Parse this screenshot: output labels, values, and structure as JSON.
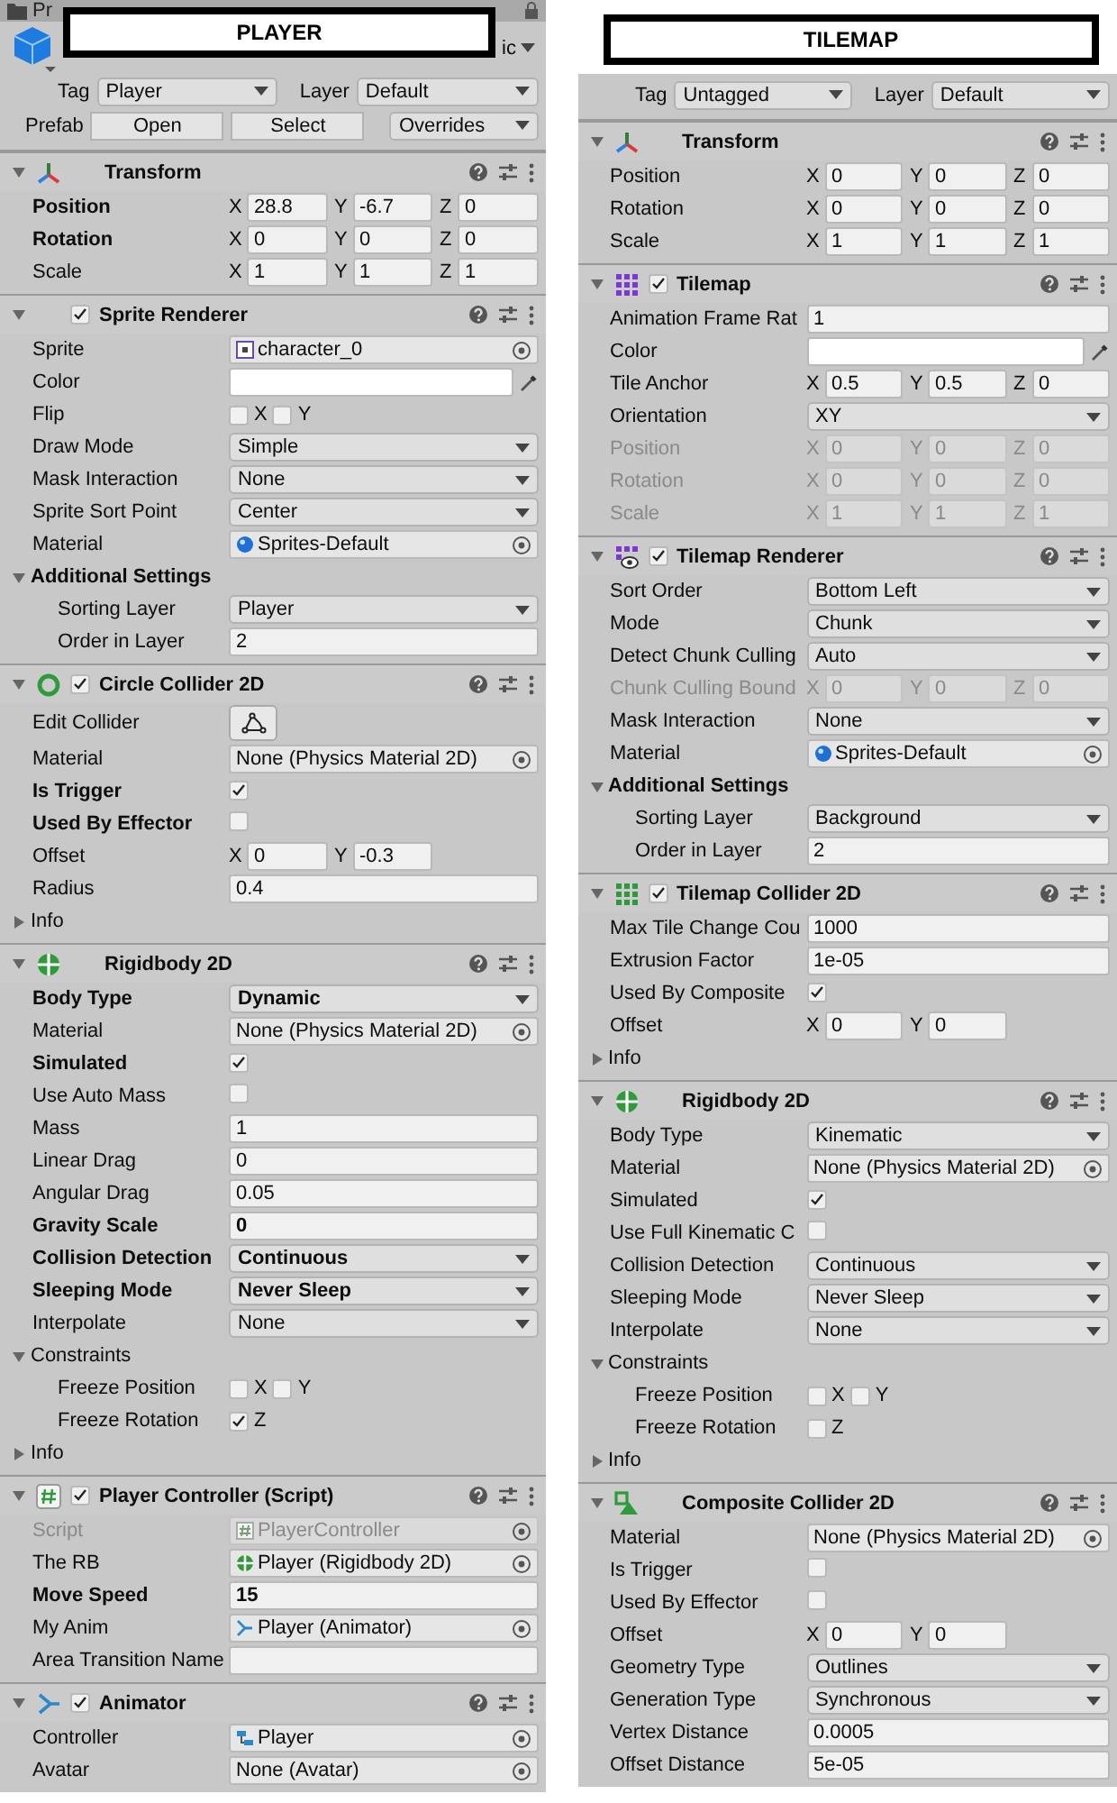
{
  "panels": [
    {
      "banner": "PLAYER",
      "tab": "Pr",
      "static": "ic",
      "tag": {
        "label": "Tag",
        "value": "Player"
      },
      "layer": {
        "label": "Layer",
        "value": "Default"
      },
      "prefab": {
        "label": "Prefab",
        "buttons": [
          "Open",
          "Select"
        ],
        "overrides": "Overrides"
      },
      "components": [
        {
          "name": "Transform",
          "kind": "transform",
          "expanded": true,
          "rows": [
            {
              "kind": "vector",
              "label": "Position",
              "overridden": true,
              "disabled": false,
              "items": [
                {
                  "axis": "X",
                  "value": "28.8"
                },
                {
                  "axis": "Y",
                  "value": "-6.7"
                },
                {
                  "axis": "Z",
                  "value": "0"
                }
              ]
            },
            {
              "kind": "vector",
              "label": "Rotation",
              "overridden": true,
              "disabled": false,
              "items": [
                {
                  "axis": "X",
                  "value": "0"
                },
                {
                  "axis": "Y",
                  "value": "0"
                },
                {
                  "axis": "Z",
                  "value": "0"
                }
              ]
            },
            {
              "kind": "vector",
              "label": "Scale",
              "overridden": false,
              "disabled": false,
              "items": [
                {
                  "axis": "X",
                  "value": "1"
                },
                {
                  "axis": "Y",
                  "value": "1"
                },
                {
                  "axis": "Z",
                  "value": "1"
                }
              ]
            }
          ]
        },
        {
          "name": "Sprite Renderer",
          "kind": "renderer",
          "enabled": true,
          "expanded": true,
          "rows": [
            {
              "kind": "sprite-ref",
              "label": "Sprite",
              "overridden": false,
              "disabled": false,
              "value": "character_0"
            },
            {
              "kind": "color",
              "label": "Color",
              "overridden": false,
              "disabled": false,
              "color": "#ffffff"
            },
            {
              "kind": "checks",
              "label": "Flip",
              "overridden": false,
              "disabled": false,
              "checks": [
                {
                  "axis": "X",
                  "checked": false
                },
                {
                  "axis": "Y",
                  "checked": false
                }
              ]
            },
            {
              "kind": "dropdown",
              "label": "Draw Mode",
              "overridden": false,
              "disabled": false,
              "value": "Simple"
            },
            {
              "kind": "dropdown",
              "label": "Mask Interaction",
              "overridden": false,
              "disabled": false,
              "value": "None"
            },
            {
              "kind": "dropdown",
              "label": "Sprite Sort Point",
              "overridden": false,
              "disabled": false,
              "value": "Center"
            },
            {
              "kind": "material-ref",
              "label": "Material",
              "overridden": false,
              "disabled": false,
              "value": "Sprites-Default"
            },
            {
              "kind": "foldout",
              "label": "Additional Settings",
              "overridden": true,
              "disabled": false,
              "expanded": true,
              "children": [
                {
                  "kind": "dropdown",
                  "label": "Sorting Layer",
                  "overridden": false,
                  "disabled": false,
                  "value": "Player"
                },
                {
                  "kind": "number",
                  "label": "Order in Layer",
                  "overridden": false,
                  "disabled": false,
                  "value": "2"
                }
              ]
            }
          ]
        },
        {
          "name": "Circle Collider 2D",
          "kind": "circle-collider",
          "enabled": true,
          "expanded": true,
          "rows": [
            {
              "kind": "edit-button",
              "label": "Edit Collider",
              "overridden": false,
              "disabled": false
            },
            {
              "kind": "object",
              "label": "Material",
              "overridden": false,
              "disabled": false,
              "value": "None (Physics Material 2D)"
            },
            {
              "kind": "checkbox",
              "label": "Is Trigger",
              "overridden": true,
              "disabled": false,
              "checked": true
            },
            {
              "kind": "checkbox",
              "label": "Used By Effector",
              "overridden": true,
              "disabled": false,
              "checked": false
            },
            {
              "kind": "vector",
              "label": "Offset",
              "overridden": false,
              "disabled": false,
              "items": [
                {
                  "axis": "X",
                  "value": "0"
                },
                {
                  "axis": "Y",
                  "value": "-0.3"
                }
              ]
            },
            {
              "kind": "number",
              "label": "Radius",
              "overridden": false,
              "disabled": false,
              "value": "0.4"
            },
            {
              "kind": "foldout",
              "label": "Info",
              "overridden": false,
              "disabled": false,
              "expanded": false
            }
          ]
        },
        {
          "name": "Rigidbody 2D",
          "kind": "rigidbody",
          "expanded": true,
          "rows": [
            {
              "kind": "dropdown",
              "label": "Body Type",
              "overridden": true,
              "disabled": false,
              "value": "Dynamic"
            },
            {
              "kind": "object",
              "label": "Material",
              "overridden": false,
              "disabled": false,
              "value": "None (Physics Material 2D)"
            },
            {
              "kind": "checkbox",
              "label": "Simulated",
              "overridden": true,
              "disabled": false,
              "checked": true
            },
            {
              "kind": "checkbox",
              "label": "Use Auto Mass",
              "overridden": false,
              "disabled": false,
              "checked": false
            },
            {
              "kind": "number",
              "label": "Mass",
              "overridden": false,
              "disabled": false,
              "value": "1"
            },
            {
              "kind": "number",
              "label": "Linear Drag",
              "overridden": false,
              "disabled": false,
              "value": "0"
            },
            {
              "kind": "number",
              "label": "Angular Drag",
              "overridden": false,
              "disabled": false,
              "value": "0.05"
            },
            {
              "kind": "number",
              "label": "Gravity Scale",
              "overridden": true,
              "disabled": false,
              "value": "0"
            },
            {
              "kind": "dropdown",
              "label": "Collision Detection",
              "overridden": true,
              "disabled": false,
              "value": "Continuous"
            },
            {
              "kind": "dropdown",
              "label": "Sleeping Mode",
              "overridden": true,
              "disabled": false,
              "value": "Never Sleep"
            },
            {
              "kind": "dropdown",
              "label": "Interpolate",
              "overridden": false,
              "disabled": false,
              "value": "None"
            },
            {
              "kind": "foldout",
              "label": "Constraints",
              "overridden": false,
              "disabled": false,
              "expanded": true,
              "children": [
                {
                  "kind": "checks",
                  "label": "Freeze Position",
                  "overridden": false,
                  "disabled": false,
                  "checks": [
                    {
                      "axis": "X",
                      "checked": false
                    },
                    {
                      "axis": "Y",
                      "checked": false
                    }
                  ]
                },
                {
                  "kind": "checks",
                  "label": "Freeze Rotation",
                  "overridden": false,
                  "disabled": false,
                  "checks": [
                    {
                      "axis": "Z",
                      "checked": true
                    }
                  ]
                }
              ]
            },
            {
              "kind": "foldout",
              "label": "Info",
              "overridden": false,
              "disabled": false,
              "expanded": false
            }
          ]
        },
        {
          "name": "Player Controller (Script)",
          "kind": "script",
          "enabled": true,
          "expanded": true,
          "rows": [
            {
              "kind": "script-ref",
              "label": "Script",
              "overridden": false,
              "disabled": true,
              "value": "PlayerController"
            },
            {
              "kind": "rigidbody-ref",
              "label": "The RB",
              "overridden": false,
              "disabled": false,
              "value": "Player (Rigidbody 2D)"
            },
            {
              "kind": "number",
              "label": "Move Speed",
              "overridden": true,
              "disabled": false,
              "value": "15"
            },
            {
              "kind": "animator-ref",
              "label": "My Anim",
              "overridden": false,
              "disabled": false,
              "value": "Player (Animator)"
            },
            {
              "kind": "number",
              "label": "Area Transition Name",
              "overridden": false,
              "disabled": false
            }
          ]
        },
        {
          "name": "Animator",
          "kind": "animator",
          "enabled": true,
          "expanded": true,
          "rows": [
            {
              "kind": "controller-ref",
              "label": "Controller",
              "overridden": false,
              "disabled": false,
              "value": "Player"
            },
            {
              "kind": "object",
              "label": "Avatar",
              "overridden": false,
              "disabled": false,
              "value": "None (Avatar)"
            }
          ]
        }
      ]
    },
    {
      "banner": "TILEMAP",
      "tag": {
        "label": "Tag",
        "value": "Untagged"
      },
      "layer": {
        "label": "Layer",
        "value": "Default"
      },
      "components": [
        {
          "name": "Transform",
          "kind": "transform",
          "expanded": true,
          "rows": [
            {
              "kind": "vector",
              "label": "Position",
              "overridden": false,
              "disabled": false,
              "items": [
                {
                  "axis": "X",
                  "value": "0"
                },
                {
                  "axis": "Y",
                  "value": "0"
                },
                {
                  "axis": "Z",
                  "value": "0"
                }
              ]
            },
            {
              "kind": "vector",
              "label": "Rotation",
              "overridden": false,
              "disabled": false,
              "items": [
                {
                  "axis": "X",
                  "value": "0"
                },
                {
                  "axis": "Y",
                  "value": "0"
                },
                {
                  "axis": "Z",
                  "value": "0"
                }
              ]
            },
            {
              "kind": "vector",
              "label": "Scale",
              "overridden": false,
              "disabled": false,
              "items": [
                {
                  "axis": "X",
                  "value": "1"
                },
                {
                  "axis": "Y",
                  "value": "1"
                },
                {
                  "axis": "Z",
                  "value": "1"
                }
              ]
            }
          ]
        },
        {
          "name": "Tilemap",
          "kind": "tilemap",
          "enabled": true,
          "expanded": true,
          "rows": [
            {
              "kind": "number",
              "label": "Animation Frame Rat",
              "overridden": false,
              "disabled": false,
              "value": "1"
            },
            {
              "kind": "color",
              "label": "Color",
              "overridden": false,
              "disabled": false,
              "color": "#ffffff"
            },
            {
              "kind": "vector",
              "label": "Tile Anchor",
              "overridden": false,
              "disabled": false,
              "items": [
                {
                  "axis": "X",
                  "value": "0.5"
                },
                {
                  "axis": "Y",
                  "value": "0.5"
                },
                {
                  "axis": "Z",
                  "value": "0"
                }
              ]
            },
            {
              "kind": "dropdown",
              "label": "Orientation",
              "overridden": false,
              "disabled": false,
              "value": "XY"
            },
            {
              "kind": "vector",
              "label": "Position",
              "overridden": false,
              "disabled": true,
              "items": [
                {
                  "axis": "X",
                  "value": "0"
                },
                {
                  "axis": "Y",
                  "value": "0"
                },
                {
                  "axis": "Z",
                  "value": "0"
                }
              ]
            },
            {
              "kind": "vector",
              "label": "Rotation",
              "overridden": false,
              "disabled": true,
              "items": [
                {
                  "axis": "X",
                  "value": "0"
                },
                {
                  "axis": "Y",
                  "value": "0"
                },
                {
                  "axis": "Z",
                  "value": "0"
                }
              ]
            },
            {
              "kind": "vector",
              "label": "Scale",
              "overridden": false,
              "disabled": true,
              "items": [
                {
                  "axis": "X",
                  "value": "1"
                },
                {
                  "axis": "Y",
                  "value": "1"
                },
                {
                  "axis": "Z",
                  "value": "1"
                }
              ]
            }
          ]
        },
        {
          "name": "Tilemap Renderer",
          "kind": "tilemap-renderer",
          "enabled": true,
          "expanded": true,
          "rows": [
            {
              "kind": "dropdown",
              "label": "Sort Order",
              "overridden": false,
              "disabled": false,
              "value": "Bottom Left"
            },
            {
              "kind": "dropdown",
              "label": "Mode",
              "overridden": false,
              "disabled": false,
              "value": "Chunk"
            },
            {
              "kind": "dropdown",
              "label": "Detect Chunk Culling",
              "overridden": false,
              "disabled": false,
              "value": "Auto"
            },
            {
              "kind": "vector",
              "label": "Chunk Culling Bound",
              "overridden": false,
              "disabled": true,
              "items": [
                {
                  "axis": "X",
                  "value": "0"
                },
                {
                  "axis": "Y",
                  "value": "0"
                },
                {
                  "axis": "Z",
                  "value": "0"
                }
              ]
            },
            {
              "kind": "dropdown",
              "label": "Mask Interaction",
              "overridden": false,
              "disabled": false,
              "value": "None"
            },
            {
              "kind": "material-ref",
              "label": "Material",
              "overridden": false,
              "disabled": false,
              "value": "Sprites-Default"
            },
            {
              "kind": "foldout",
              "label": "Additional Settings",
              "overridden": true,
              "disabled": false,
              "expanded": true,
              "children": [
                {
                  "kind": "dropdown",
                  "label": "Sorting Layer",
                  "overridden": false,
                  "disabled": false,
                  "value": "Background"
                },
                {
                  "kind": "number",
                  "label": "Order in Layer",
                  "overridden": false,
                  "disabled": false,
                  "value": "2"
                }
              ]
            }
          ]
        },
        {
          "name": "Tilemap Collider 2D",
          "kind": "tilemap-collider",
          "enabled": true,
          "expanded": true,
          "rows": [
            {
              "kind": "number",
              "label": "Max Tile Change Cou",
              "overridden": false,
              "disabled": false,
              "value": "1000"
            },
            {
              "kind": "number",
              "label": "Extrusion Factor",
              "overridden": false,
              "disabled": false,
              "value": "1e-05"
            },
            {
              "kind": "checkbox",
              "label": "Used By Composite",
              "overridden": false,
              "disabled": false,
              "checked": true
            },
            {
              "kind": "vector",
              "label": "Offset",
              "overridden": false,
              "disabled": false,
              "items": [
                {
                  "axis": "X",
                  "value": "0"
                },
                {
                  "axis": "Y",
                  "value": "0"
                }
              ]
            },
            {
              "kind": "foldout",
              "label": "Info",
              "overridden": false,
              "disabled": false,
              "expanded": false
            }
          ]
        },
        {
          "name": "Rigidbody 2D",
          "kind": "rigidbody",
          "expanded": true,
          "rows": [
            {
              "kind": "dropdown",
              "label": "Body Type",
              "overridden": false,
              "disabled": false,
              "value": "Kinematic"
            },
            {
              "kind": "object",
              "label": "Material",
              "overridden": false,
              "disabled": false,
              "value": "None (Physics Material 2D)"
            },
            {
              "kind": "checkbox",
              "label": "Simulated",
              "overridden": false,
              "disabled": false,
              "checked": true
            },
            {
              "kind": "checkbox",
              "label": "Use Full Kinematic C",
              "overridden": false,
              "disabled": false,
              "checked": false
            },
            {
              "kind": "dropdown",
              "label": "Collision Detection",
              "overridden": false,
              "disabled": false,
              "value": "Continuous"
            },
            {
              "kind": "dropdown",
              "label": "Sleeping Mode",
              "overridden": false,
              "disabled": false,
              "value": "Never Sleep"
            },
            {
              "kind": "dropdown",
              "label": "Interpolate",
              "overridden": false,
              "disabled": false,
              "value": "None"
            },
            {
              "kind": "foldout",
              "label": "Constraints",
              "overridden": false,
              "disabled": false,
              "expanded": true,
              "children": [
                {
                  "kind": "checks",
                  "label": "Freeze Position",
                  "overridden": false,
                  "disabled": false,
                  "checks": [
                    {
                      "axis": "X",
                      "checked": false
                    },
                    {
                      "axis": "Y",
                      "checked": false
                    }
                  ]
                },
                {
                  "kind": "checks",
                  "label": "Freeze Rotation",
                  "overridden": false,
                  "disabled": false,
                  "checks": [
                    {
                      "axis": "Z",
                      "checked": false
                    }
                  ]
                }
              ]
            },
            {
              "kind": "foldout",
              "label": "Info",
              "overridden": false,
              "disabled": false,
              "expanded": false
            }
          ]
        },
        {
          "name": "Composite Collider 2D",
          "kind": "composite-collider",
          "expanded": true,
          "rows": [
            {
              "kind": "object",
              "label": "Material",
              "overridden": false,
              "disabled": false,
              "value": "None (Physics Material 2D)"
            },
            {
              "kind": "checkbox",
              "label": "Is Trigger",
              "overridden": false,
              "disabled": false,
              "checked": false
            },
            {
              "kind": "checkbox",
              "label": "Used By Effector",
              "overridden": false,
              "disabled": false,
              "checked": false
            },
            {
              "kind": "vector",
              "label": "Offset",
              "overridden": false,
              "disabled": false,
              "items": [
                {
                  "axis": "X",
                  "value": "0"
                },
                {
                  "axis": "Y",
                  "value": "0"
                }
              ]
            },
            {
              "kind": "dropdown",
              "label": "Geometry Type",
              "overridden": false,
              "disabled": false,
              "value": "Outlines"
            },
            {
              "kind": "dropdown",
              "label": "Generation Type",
              "overridden": false,
              "disabled": false,
              "value": "Synchronous"
            },
            {
              "kind": "number",
              "label": "Vertex Distance",
              "overridden": false,
              "disabled": false,
              "value": "0.0005"
            },
            {
              "kind": "number",
              "label": "Offset Distance",
              "overridden": false,
              "disabled": false,
              "value": "5e-05"
            }
          ]
        }
      ]
    }
  ]
}
